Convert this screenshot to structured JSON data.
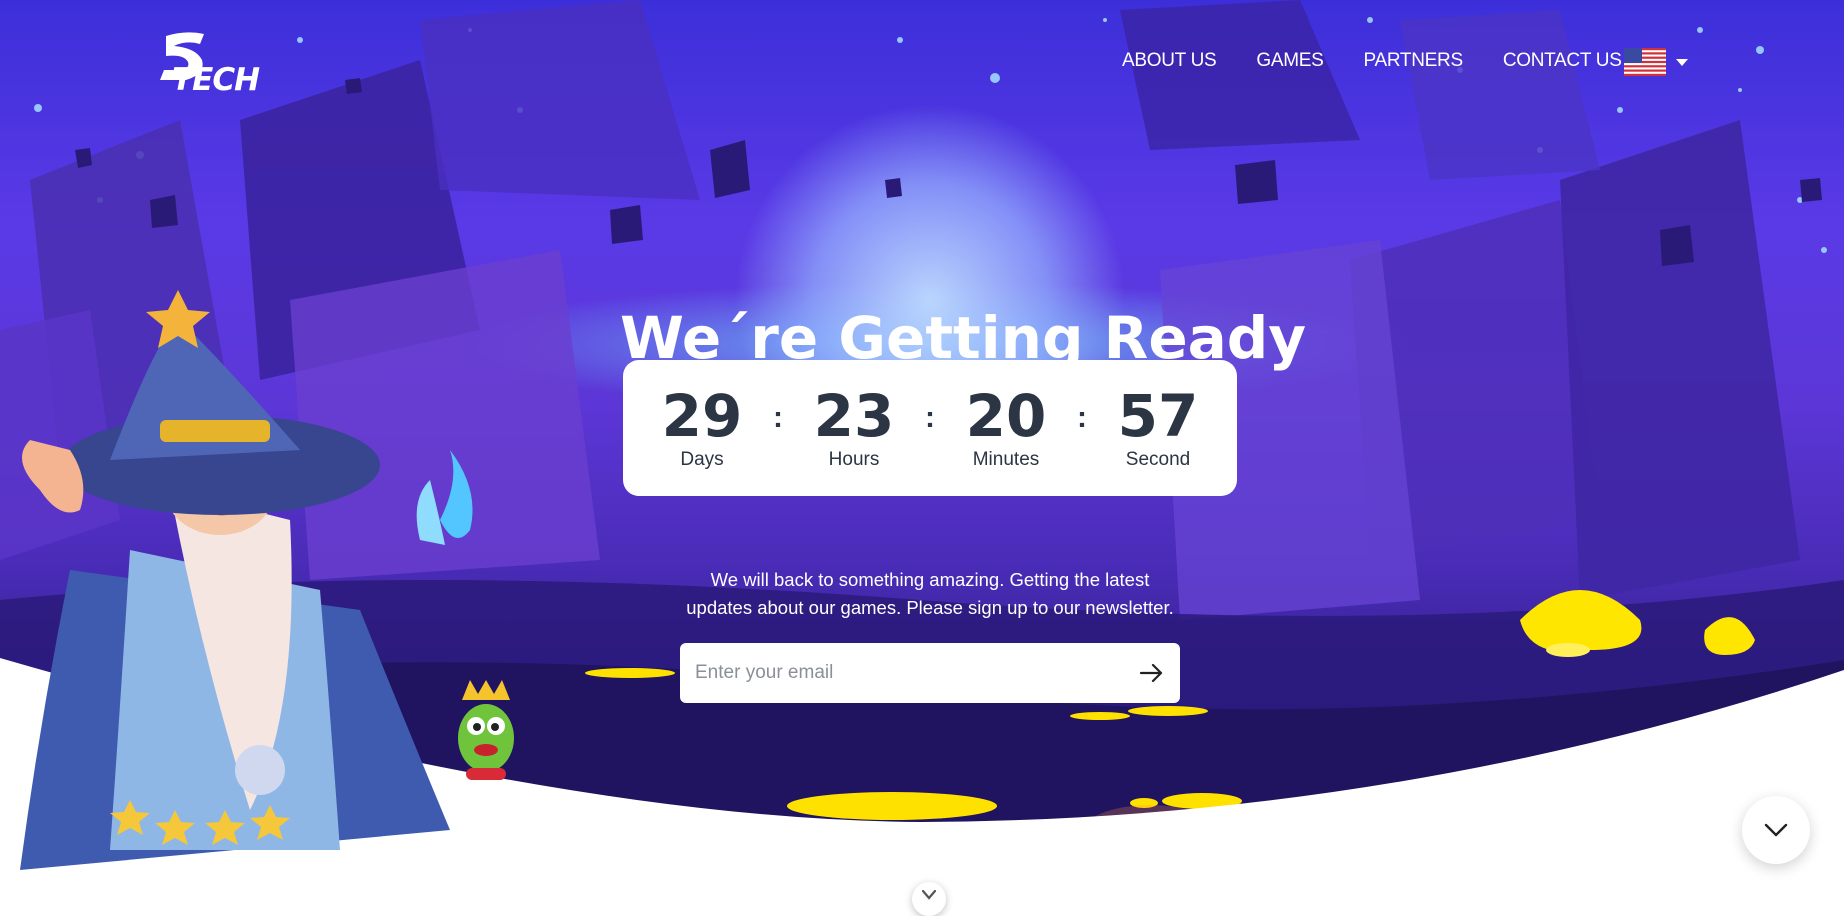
{
  "brand": {
    "logo_text": "TECH"
  },
  "nav": {
    "items": [
      {
        "label": "ABOUT US"
      },
      {
        "label": "GAMES"
      },
      {
        "label": "PARTNERS"
      },
      {
        "label": "CONTACT US"
      }
    ],
    "language_flag": "us-flag-icon"
  },
  "hero": {
    "headline": "We´re Getting Ready",
    "countdown": {
      "days": "29",
      "days_label": "Days",
      "hours": "23",
      "hours_label": "Hours",
      "minutes": "20",
      "minutes_label": "Minutes",
      "seconds": "57",
      "seconds_label": "Second",
      "separator": ":"
    },
    "tagline_line1": "We will back to something amazing. Getting the latest",
    "tagline_line2": "updates about our games. Please sign up to our newsletter.",
    "email_placeholder": "Enter your email"
  },
  "icons": {
    "send": "arrow-right-icon",
    "scroll_down": "chevron-down-icon"
  },
  "colors": {
    "sky_top": "#3c2fd9",
    "sky_bottom": "#1e1560",
    "text_dark": "#2b3544",
    "lava": "#ffe100"
  }
}
